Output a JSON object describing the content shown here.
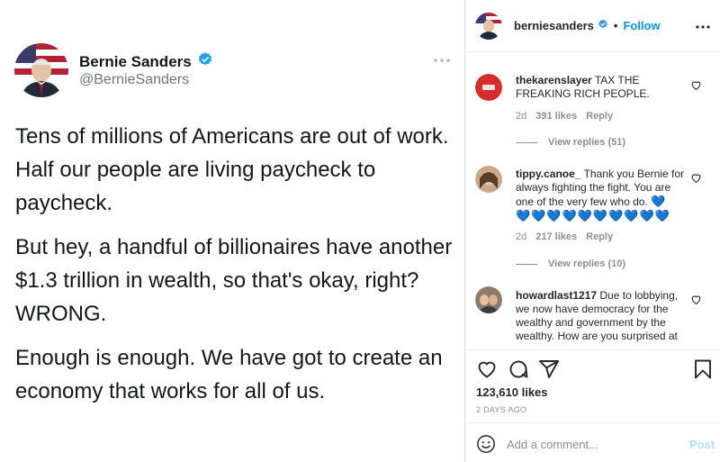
{
  "tweet": {
    "name": "Bernie Sanders",
    "handle": "@BernieSanders",
    "paragraphs": [
      "Tens of millions of Americans are out of work. Half our people are living paycheck to paycheck.",
      "But hey, a handful of billionaires have another $1.3 trillion in wealth, so that's okay, right? WRONG.",
      "Enough is enough. We have got to create an economy that works for all of us."
    ],
    "verified_color": "#1da1f2"
  },
  "instagram": {
    "header": {
      "username": "berniesanders",
      "dot": "•",
      "follow": "Follow"
    },
    "comments": [
      {
        "username": "thekarenslayer",
        "text": "TAX THE FREAKING RICH PEOPLE.",
        "time": "2d",
        "likes": "391 likes",
        "reply": "Reply",
        "view_replies": "View replies (51)"
      },
      {
        "username": "tippy.canoe_",
        "text": "Thank you Bernie for always fighting the fight. You are one of the very few who do.",
        "hearts": "💙💙💙💙💙💙💙💙💙💙",
        "hearts_lead": "💙",
        "time": "2d",
        "likes": "217 likes",
        "reply": "Reply",
        "view_replies": "View replies (10)"
      },
      {
        "username": "howardlast1217",
        "text": "Due to lobbying, we now have democracy for the wealthy and government by the wealthy. How are you surprised at all?"
      }
    ],
    "likes": "123,610 likes",
    "posted": "2 DAYS AGO",
    "add_comment_placeholder": "Add a comment...",
    "post_label": "Post",
    "icons": [
      "heart-icon",
      "comment-icon",
      "share-icon",
      "bookmark-icon",
      "emoji-icon",
      "more-icon",
      "verified-icon"
    ]
  }
}
